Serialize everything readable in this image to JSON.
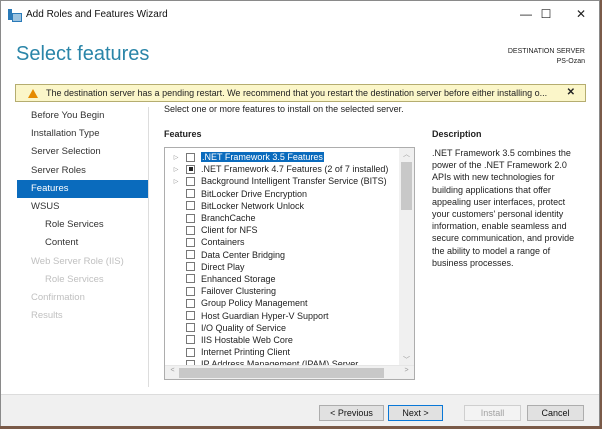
{
  "window": {
    "title": "Add Roles and Features Wizard",
    "minimize": "—",
    "maximize": "☐",
    "close": "✕"
  },
  "header": {
    "title": "Select features",
    "dest_label": "DESTINATION SERVER",
    "dest_server": "PS-Ozan"
  },
  "warning": {
    "text": "The destination server has a pending restart. We recommend that you restart the destination server before either installing o...",
    "close": "✕"
  },
  "nav": [
    {
      "label": "Before You Begin",
      "state": "normal"
    },
    {
      "label": "Installation Type",
      "state": "normal"
    },
    {
      "label": "Server Selection",
      "state": "normal"
    },
    {
      "label": "Server Roles",
      "state": "normal"
    },
    {
      "label": "Features",
      "state": "selected"
    },
    {
      "label": "WSUS",
      "state": "normal"
    },
    {
      "label": "Role Services",
      "state": "normal",
      "sub": true
    },
    {
      "label": "Content",
      "state": "normal",
      "sub": true
    },
    {
      "label": "Web Server Role (IIS)",
      "state": "disabled"
    },
    {
      "label": "Role Services",
      "state": "disabled",
      "sub": true
    },
    {
      "label": "Confirmation",
      "state": "disabled"
    },
    {
      "label": "Results",
      "state": "disabled"
    }
  ],
  "main": {
    "intro": "Select one or more features to install on the selected server.",
    "features_label": "Features",
    "features": [
      {
        "label": ".NET Framework 3.5 Features",
        "expandable": true,
        "state": "unchecked",
        "highlighted": true
      },
      {
        "label": ".NET Framework 4.7 Features (2 of 7 installed)",
        "expandable": true,
        "state": "partial"
      },
      {
        "label": "Background Intelligent Transfer Service (BITS)",
        "expandable": true,
        "state": "unchecked"
      },
      {
        "label": "BitLocker Drive Encryption",
        "state": "unchecked"
      },
      {
        "label": "BitLocker Network Unlock",
        "state": "unchecked"
      },
      {
        "label": "BranchCache",
        "state": "unchecked"
      },
      {
        "label": "Client for NFS",
        "state": "unchecked"
      },
      {
        "label": "Containers",
        "state": "unchecked"
      },
      {
        "label": "Data Center Bridging",
        "state": "unchecked"
      },
      {
        "label": "Direct Play",
        "state": "unchecked"
      },
      {
        "label": "Enhanced Storage",
        "state": "unchecked"
      },
      {
        "label": "Failover Clustering",
        "state": "unchecked"
      },
      {
        "label": "Group Policy Management",
        "state": "unchecked"
      },
      {
        "label": "Host Guardian Hyper-V Support",
        "state": "unchecked"
      },
      {
        "label": "I/O Quality of Service",
        "state": "unchecked"
      },
      {
        "label": "IIS Hostable Web Core",
        "state": "unchecked"
      },
      {
        "label": "Internet Printing Client",
        "state": "unchecked"
      },
      {
        "label": "IP Address Management (IPAM) Server",
        "state": "unchecked"
      }
    ],
    "description_label": "Description",
    "description": ".NET Framework 3.5 combines the power of the .NET Framework 2.0 APIs with new technologies for building applications that offer appealing user interfaces, protect your customers' personal identity information, enable seamless and secure communication, and provide the ability to model a range of business processes."
  },
  "buttons": {
    "previous": "< Previous",
    "next": "Next >",
    "install": "Install",
    "cancel": "Cancel"
  }
}
